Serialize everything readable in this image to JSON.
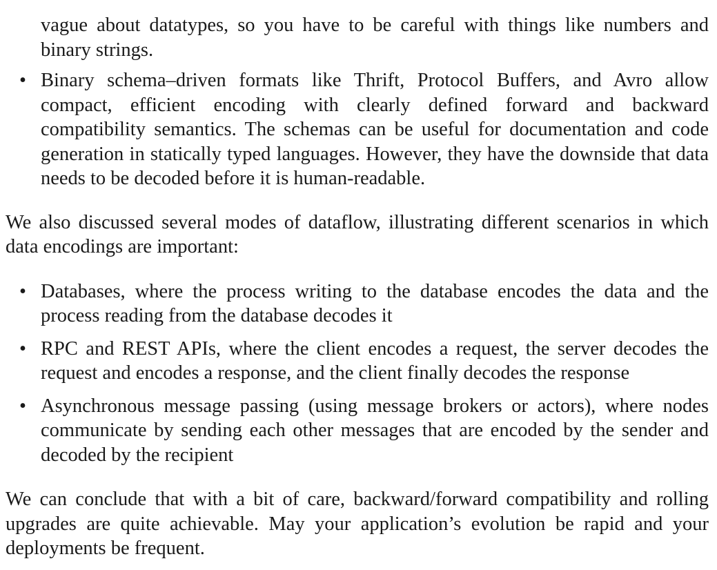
{
  "top_continuation": "vague about datatypes, so you have to be careful with things like numbers and binary strings.",
  "list1": {
    "items": [
      "Binary schema–driven formats like Thrift, Protocol Buffers, and Avro allow compact, efficient encoding with clearly defined forward and backward compatibility semantics. The schemas can be useful for documentation and code generation in statically typed languages. However, they have the downside that data needs to be decoded before it is human-readable."
    ]
  },
  "paragraph1": "We also discussed several modes of dataflow, illustrating different scenarios in which data encodings are important:",
  "list2": {
    "items": [
      "Databases, where the process writing to the database encodes the data and the process reading from the database decodes it",
      "RPC and REST APIs, where the client encodes a request, the server decodes the request and encodes a response, and the client finally decodes the response",
      "Asynchronous message passing (using message brokers or actors), where nodes communicate by sending each other messages that are encoded by the sender and decoded by the recipient"
    ]
  },
  "paragraph2": "We can conclude that with a bit of care, backward/forward compatibility and rolling upgrades are quite achievable. May your application’s evolution be rapid and your deployments be frequent.",
  "bullet_glyph": "•"
}
